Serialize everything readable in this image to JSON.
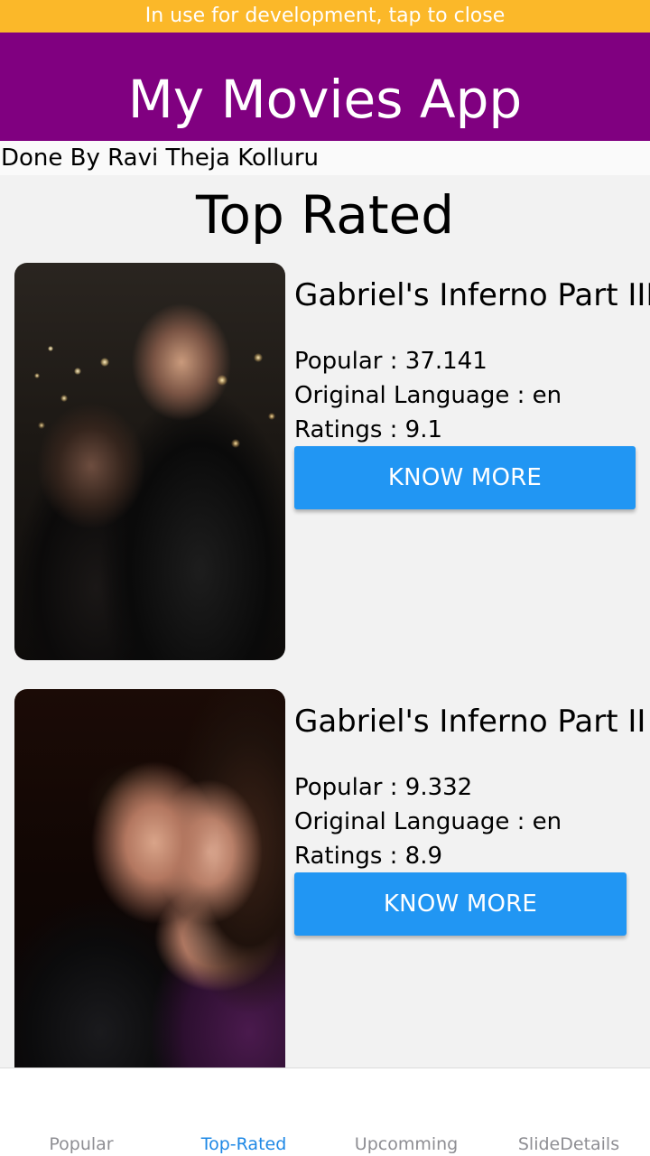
{
  "dev_banner": {
    "text": "In use for development, tap to close"
  },
  "header": {
    "title": "My Movies App"
  },
  "credit": {
    "text": "Done By Ravi Theja Kolluru"
  },
  "section": {
    "title": "Top Rated"
  },
  "movies": [
    {
      "title": "Gabriel's Inferno Part III",
      "popular": "Popular : 37.141",
      "language": "Original Language : en",
      "ratings": "Ratings : 9.1",
      "button": "KNOW MORE"
    },
    {
      "title": "Gabriel's Inferno Part II",
      "popular": "Popular : 9.332",
      "language": "Original Language : en",
      "ratings": "Ratings : 8.9",
      "button": "KNOW MORE"
    }
  ],
  "tabs": [
    {
      "label": "Popular",
      "active": false
    },
    {
      "label": "Top-Rated",
      "active": true
    },
    {
      "label": "Upcomming",
      "active": false
    },
    {
      "label": "SlideDetails",
      "active": false
    }
  ],
  "colors": {
    "banner": "#fbb829",
    "header": "#800080",
    "button": "#2196f3",
    "active_tab": "#1e88e5",
    "inactive_tab": "#8e8e93"
  }
}
